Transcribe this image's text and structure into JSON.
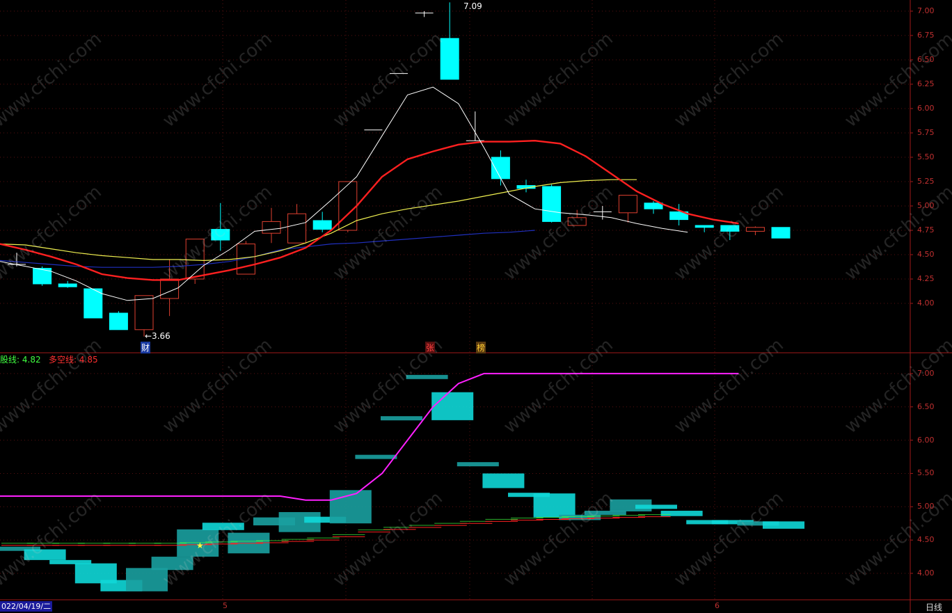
{
  "colors": {
    "up": "#e04030",
    "down": "#00ffff",
    "ma5": "#ffffff",
    "ma10": "#ff2020",
    "ma20": "#f0f050",
    "ma60": "#2030c0",
    "trend": "#ff20ff",
    "short_line": "#40ff40",
    "axis": "#a01818"
  },
  "watermark": "www.cfchi.com",
  "header": {
    "short_label": "股线:",
    "short_value": "4.82",
    "long_label": "多空线:",
    "long_value": "4.85"
  },
  "footer": {
    "date": "022/04/19/二",
    "month_ticks": [
      "5",
      "6"
    ],
    "period": "日线"
  },
  "markers": {
    "low_label": "←3.66",
    "high_label": "7.09",
    "cai": "财",
    "zhang": "张",
    "bang": "榜",
    "star": "★"
  },
  "chart_data": {
    "type": "candlestick",
    "upper": {
      "y_ticks": [
        "7.00",
        "6.75",
        "6.50",
        "6.25",
        "6.00",
        "5.75",
        "5.50",
        "5.25",
        "5.00",
        "4.75",
        "4.50",
        "4.25",
        "4.00"
      ],
      "candles": [
        {
          "o": 4.4,
          "c": 4.4,
          "h": 4.52,
          "l": 4.38
        },
        {
          "o": 4.36,
          "c": 4.2,
          "h": 4.38,
          "l": 4.18
        },
        {
          "o": 4.2,
          "c": 4.17,
          "h": 4.23,
          "l": 4.16
        },
        {
          "o": 4.15,
          "c": 3.85,
          "h": 4.15,
          "l": 3.85
        },
        {
          "o": 3.9,
          "c": 3.73,
          "h": 3.92,
          "l": 3.73
        },
        {
          "o": 3.73,
          "c": 4.08,
          "h": 4.08,
          "l": 3.66
        },
        {
          "o": 4.05,
          "c": 4.25,
          "h": 4.45,
          "l": 3.87
        },
        {
          "o": 4.25,
          "c": 4.66,
          "h": 4.66,
          "l": 4.2
        },
        {
          "o": 4.76,
          "c": 4.65,
          "h": 5.03,
          "l": 4.54
        },
        {
          "o": 4.3,
          "c": 4.61,
          "h": 4.64,
          "l": 4.3
        },
        {
          "o": 4.72,
          "c": 4.84,
          "h": 4.98,
          "l": 4.62
        },
        {
          "o": 4.62,
          "c": 4.92,
          "h": 5.02,
          "l": 4.62
        },
        {
          "o": 4.85,
          "c": 4.76,
          "h": 4.94,
          "l": 4.73
        },
        {
          "o": 4.75,
          "c": 5.25,
          "h": 5.25,
          "l": 4.73
        },
        {
          "o": 5.78,
          "c": 5.78,
          "h": 5.78,
          "l": 5.78
        },
        {
          "o": 6.36,
          "c": 6.36,
          "h": 6.36,
          "l": 6.36
        },
        {
          "o": 6.98,
          "c": 6.98,
          "h": 7.0,
          "l": 6.94
        },
        {
          "o": 6.72,
          "c": 6.3,
          "h": 7.09,
          "l": 6.3
        },
        {
          "o": 5.67,
          "c": 5.67,
          "h": 5.97,
          "l": 5.67
        },
        {
          "o": 5.5,
          "c": 5.28,
          "h": 5.57,
          "l": 5.21
        },
        {
          "o": 5.21,
          "c": 5.18,
          "h": 5.27,
          "l": 5.14
        },
        {
          "o": 5.2,
          "c": 4.84,
          "h": 5.22,
          "l": 4.83
        },
        {
          "o": 4.8,
          "c": 4.88,
          "h": 4.96,
          "l": 4.8
        },
        {
          "o": 4.94,
          "c": 4.94,
          "h": 5.0,
          "l": 4.86
        },
        {
          "o": 4.93,
          "c": 5.11,
          "h": 5.11,
          "l": 4.83
        },
        {
          "o": 5.03,
          "c": 4.97,
          "h": 5.05,
          "l": 4.92
        },
        {
          "o": 4.94,
          "c": 4.86,
          "h": 5.02,
          "l": 4.8
        },
        {
          "o": 4.8,
          "c": 4.78,
          "h": 4.8,
          "l": 4.73
        },
        {
          "o": 4.8,
          "c": 4.74,
          "h": 4.8,
          "l": 4.65
        },
        {
          "o": 4.74,
          "c": 4.78,
          "h": 4.79,
          "l": 4.7
        },
        {
          "o": 4.78,
          "c": 4.67,
          "h": 4.78,
          "l": 4.67
        }
      ],
      "ma5": [
        4.43,
        4.38,
        4.33,
        4.23,
        4.1,
        4.03,
        4.05,
        4.16,
        4.39,
        4.55,
        4.74,
        4.77,
        4.83,
        5.06,
        5.3,
        5.72,
        6.14,
        6.22,
        6.05,
        5.6,
        5.12,
        4.97,
        4.93,
        4.91,
        4.88,
        4.82,
        4.77,
        4.73
      ],
      "ma10": [
        4.61,
        4.55,
        4.48,
        4.4,
        4.3,
        4.26,
        4.24,
        4.24,
        4.29,
        4.34,
        4.4,
        4.47,
        4.57,
        4.75,
        5.0,
        5.3,
        5.48,
        5.56,
        5.63,
        5.66,
        5.66,
        5.67,
        5.64,
        5.51,
        5.33,
        5.15,
        5.02,
        4.92,
        4.86,
        4.82
      ],
      "ma20": [
        4.61,
        4.6,
        4.56,
        4.52,
        4.49,
        4.47,
        4.45,
        4.45,
        4.44,
        4.45,
        4.48,
        4.54,
        4.62,
        4.72,
        4.85,
        4.92,
        4.97,
        5.01,
        5.05,
        5.1,
        5.15,
        5.2,
        5.24,
        5.26,
        5.27,
        5.27
      ],
      "ma60": [
        4.44,
        4.42,
        4.4,
        4.38,
        4.37,
        4.37,
        4.37,
        4.38,
        4.4,
        4.43,
        4.48,
        4.55,
        4.58,
        4.61,
        4.62,
        4.64,
        4.66,
        4.68,
        4.7,
        4.72,
        4.73,
        4.75
      ]
    },
    "lower": {
      "y_ticks": [
        "7.00",
        "6.50",
        "6.00",
        "5.50",
        "5.00",
        "4.50",
        "4.00"
      ],
      "trend_line": [
        5.16,
        5.16,
        5.16,
        5.16,
        5.16,
        5.16,
        5.16,
        5.16,
        5.16,
        5.16,
        5.16,
        5.16,
        5.1,
        5.1,
        5.2,
        5.5,
        6.0,
        6.5,
        6.85,
        7.0,
        7.0,
        7.0,
        7.0,
        7.0,
        7.0,
        7.0,
        7.0,
        7.0,
        7.0,
        7.0
      ],
      "long_short_line": [
        4.42,
        4.42,
        4.42,
        4.42,
        4.42,
        4.42,
        4.42,
        4.43,
        4.44,
        4.45,
        4.46,
        4.48,
        4.5,
        4.55,
        4.62,
        4.66,
        4.69,
        4.72,
        4.75,
        4.78,
        4.8,
        4.81,
        4.82,
        4.83,
        4.84,
        4.85
      ]
    }
  }
}
